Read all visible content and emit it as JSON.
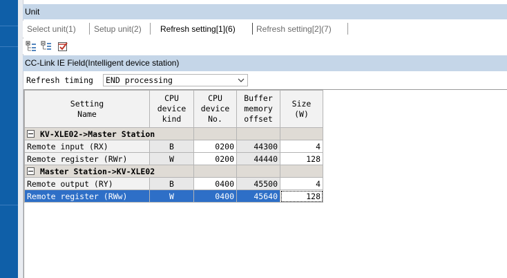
{
  "unit_header": "Unit",
  "tabs": [
    {
      "label": "Select unit(1)",
      "active": false
    },
    {
      "label": "Setup unit(2)",
      "active": false
    },
    {
      "label": "Refresh setting[1](6)",
      "active": true
    },
    {
      "label": "Refresh setting[2](7)",
      "active": false
    }
  ],
  "toolbar": {
    "icons": [
      "expand-all-icon",
      "collapse-all-icon",
      "check-settings-icon"
    ]
  },
  "section_title": "CC-Link IE Field(Intelligent device station)",
  "refresh": {
    "label": "Refresh timing",
    "value": "END processing"
  },
  "table": {
    "headers": {
      "name": "Setting\nName",
      "kind": "CPU\ndevice\nkind",
      "no": "CPU\ndevice\nNo.",
      "offset": "Buffer\nmemory\noffset",
      "size": "Size\n(W)"
    },
    "groups": [
      {
        "title": "KV-XLE02->Master Station",
        "rows": [
          {
            "name": "Remote input (RX)",
            "kind": "B",
            "no": "0200",
            "offset": "44300",
            "size": "4"
          },
          {
            "name": "Remote register (RWr)",
            "kind": "W",
            "no": "0200",
            "offset": "44440",
            "size": "128"
          }
        ]
      },
      {
        "title": "Master Station->KV-XLE02",
        "rows": [
          {
            "name": "Remote output (RY)",
            "kind": "B",
            "no": "0400",
            "offset": "45500",
            "size": "4"
          },
          {
            "name": "Remote register (RWw)",
            "kind": "W",
            "no": "0400",
            "offset": "45640",
            "size": "128"
          }
        ]
      }
    ]
  },
  "colors": {
    "header_band": "#c5d6e8",
    "left_bar": "#0f5fa8",
    "selection": "#2e6fc7",
    "group_row": "#dfdbd5"
  }
}
